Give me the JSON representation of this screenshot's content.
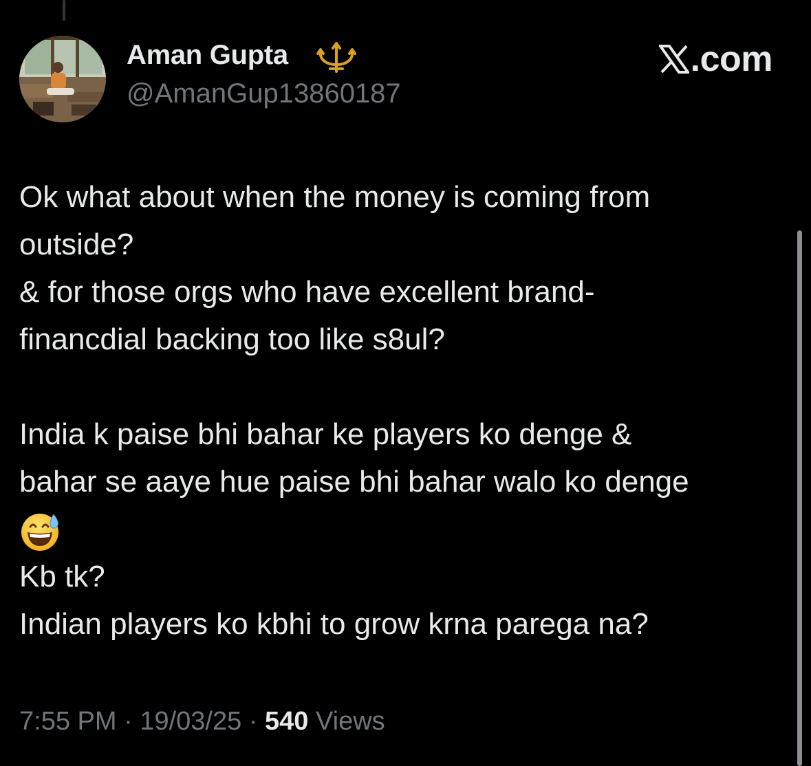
{
  "author": {
    "display_name": "Aman Gupta",
    "handle": "@AmanGup13860187",
    "badge_icon": "trident-icon",
    "avatar_icon": "profile-photo"
  },
  "brand": {
    "label": ".com",
    "logo_icon": "x-logo-icon"
  },
  "tweet": {
    "lines": [
      "Ok what about when the money is coming from",
      "outside?",
      "& for those orgs who have excellent brand-",
      "financdial backing too like s8ul?",
      "India k paise bhi bahar ke players ko denge &",
      "bahar se aaye hue paise bhi bahar walo ko denge",
      "Kb tk?",
      "Indian players ko kbhi to grow krna parega na?"
    ],
    "emoji": "grinning-face-with-sweat-emoji"
  },
  "meta": {
    "time": "7:55 PM",
    "separator": " · ",
    "date": "19/03/25",
    "views_count": "540",
    "views_label": " Views"
  },
  "colors": {
    "background": "#000000",
    "primary_text": "#e7e9ea",
    "secondary_text": "#71767b",
    "trident_gold": "#d9a21b"
  }
}
